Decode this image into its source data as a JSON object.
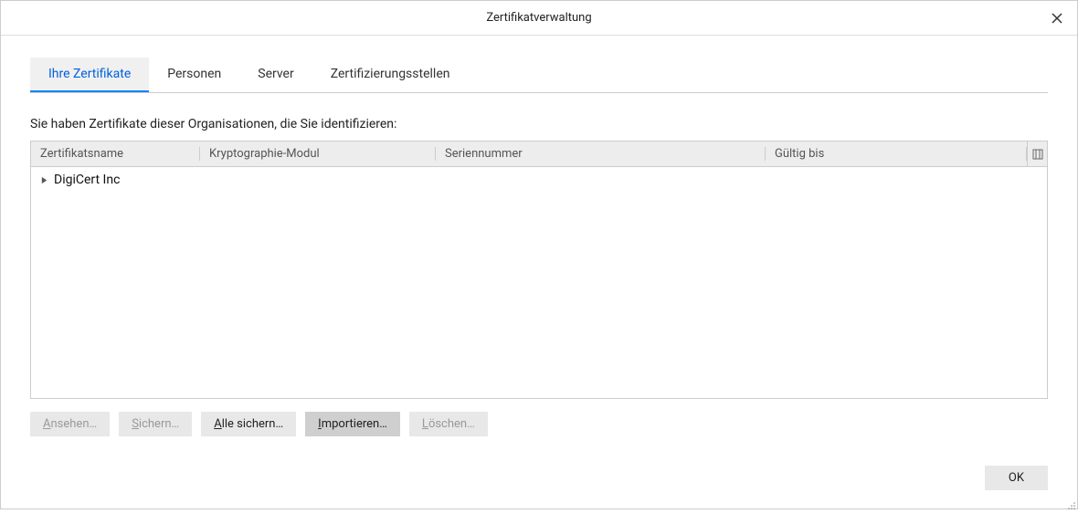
{
  "dialog": {
    "title": "Zertifikatverwaltung"
  },
  "tabs": [
    {
      "label": "Ihre Zertifikate",
      "active": true
    },
    {
      "label": "Personen",
      "active": false
    },
    {
      "label": "Server",
      "active": false
    },
    {
      "label": "Zertifizierungsstellen",
      "active": false
    }
  ],
  "description": "Sie haben Zertifikate dieser Organisationen, die Sie identifizieren:",
  "columns": {
    "name": "Zertifikatsname",
    "crypto": "Kryptographie-Modul",
    "serial": "Seriennummer",
    "valid": "Gültig bis"
  },
  "rows": [
    {
      "label": "DigiCert Inc",
      "expanded": false
    }
  ],
  "buttons": {
    "view": "Ansehen…",
    "backup": "Sichern…",
    "backup_all": "Alle sichern…",
    "import": "Importieren…",
    "delete": "Löschen…"
  },
  "footer": {
    "ok": "OK"
  }
}
